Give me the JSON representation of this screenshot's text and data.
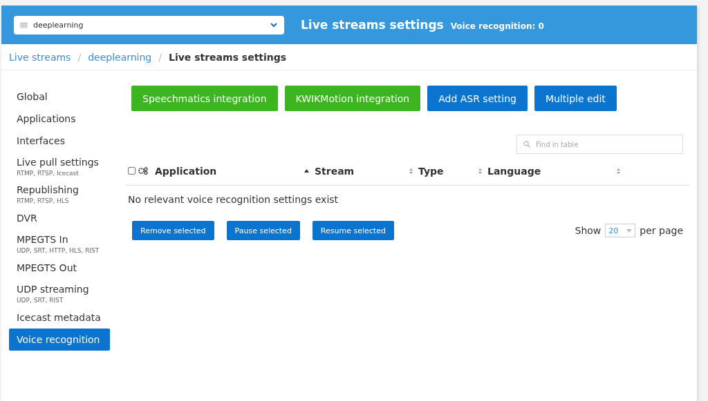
{
  "header": {
    "stream_select": {
      "value": "deeplearning"
    },
    "title": "Live streams settings",
    "subtitle": "Voice recognition: 0"
  },
  "breadcrumb": [
    {
      "label": "Live streams",
      "kind": "link"
    },
    {
      "label": "/",
      "kind": "separator"
    },
    {
      "label": "deeplearning",
      "kind": "link"
    },
    {
      "label": "/",
      "kind": "separator"
    },
    {
      "label": "Live streams settings",
      "kind": "current"
    }
  ],
  "sidebar": {
    "items": [
      {
        "label": "Global",
        "selected": false
      },
      {
        "label": "Applications",
        "selected": false
      },
      {
        "label": "Interfaces",
        "selected": false
      },
      {
        "label": "Live pull settings",
        "sub": "RTMP, RTSP, Icecast",
        "selected": false
      },
      {
        "label": "Republishing",
        "sub": "RTMP, RTSP, HLS",
        "selected": false
      },
      {
        "label": "DVR",
        "selected": false
      },
      {
        "label": "MPEGTS In",
        "sub": "UDP, SRT, HTTP, HLS, RIST",
        "selected": false
      },
      {
        "label": "MPEGTS Out",
        "selected": false
      },
      {
        "label": "UDP streaming",
        "sub": "UDP, SRT, RIST",
        "selected": false
      },
      {
        "label": "Icecast metadata",
        "selected": false
      },
      {
        "label": "Voice recognition",
        "selected": true
      }
    ]
  },
  "actions": [
    {
      "label": "Speechmatics integration",
      "kind": "success"
    },
    {
      "label": "KWIKMotion integration",
      "kind": "success"
    },
    {
      "label": "Add ASR setting",
      "kind": "primary"
    },
    {
      "label": "Multiple edit",
      "kind": "primary"
    }
  ],
  "search": {
    "placeholder": "Find in table"
  },
  "table": {
    "select_all": {
      "checked": false
    },
    "columns": [
      {
        "label": "Application",
        "sorted": true
      },
      {
        "label": "Stream",
        "sorted": false
      },
      {
        "label": "Type",
        "sorted": false
      },
      {
        "label": "Language",
        "sorted": false
      }
    ],
    "empty_text": "No relevant voice recognition settings exist"
  },
  "bulk_actions": [
    "Remove selected",
    "Pause selected",
    "Resume selected"
  ],
  "pagination": {
    "show_label": "Show",
    "page_size": "20",
    "per_page_label": "per page"
  }
}
